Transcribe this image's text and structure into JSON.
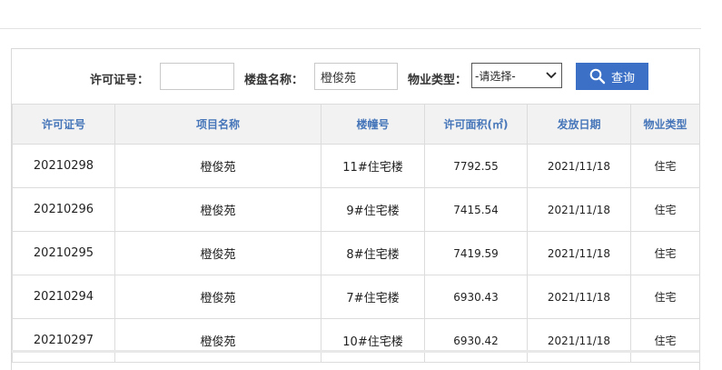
{
  "search": {
    "license_label": "许可证号：",
    "license_value": "",
    "project_label": "楼盘名称：",
    "project_value": "橙俊苑",
    "property_type_label": "物业类型：",
    "property_type_selected": "-请选择-",
    "search_button_label": "查询"
  },
  "table": {
    "headers": [
      "许可证号",
      "项目名称",
      "楼幢号",
      "许可面积(㎡)",
      "发放日期",
      "物业类型"
    ],
    "rows": [
      [
        "20210298",
        "橙俊苑",
        "11#住宅楼",
        "7792.55",
        "2021/11/18",
        "住宅"
      ],
      [
        "20210296",
        "橙俊苑",
        "9#住宅楼",
        "7415.54",
        "2021/11/18",
        "住宅"
      ],
      [
        "20210295",
        "橙俊苑",
        "8#住宅楼",
        "7419.59",
        "2021/11/18",
        "住宅"
      ],
      [
        "20210294",
        "橙俊苑",
        "7#住宅楼",
        "6930.43",
        "2021/11/18",
        "住宅"
      ],
      [
        "20210297",
        "橙俊苑",
        "10#住宅楼",
        "6930.42",
        "2021/11/18",
        "住宅"
      ]
    ]
  },
  "colors": {
    "accent": "#3b70c6",
    "header_text": "#4676b9",
    "header_bg": "#f2f2f2"
  }
}
